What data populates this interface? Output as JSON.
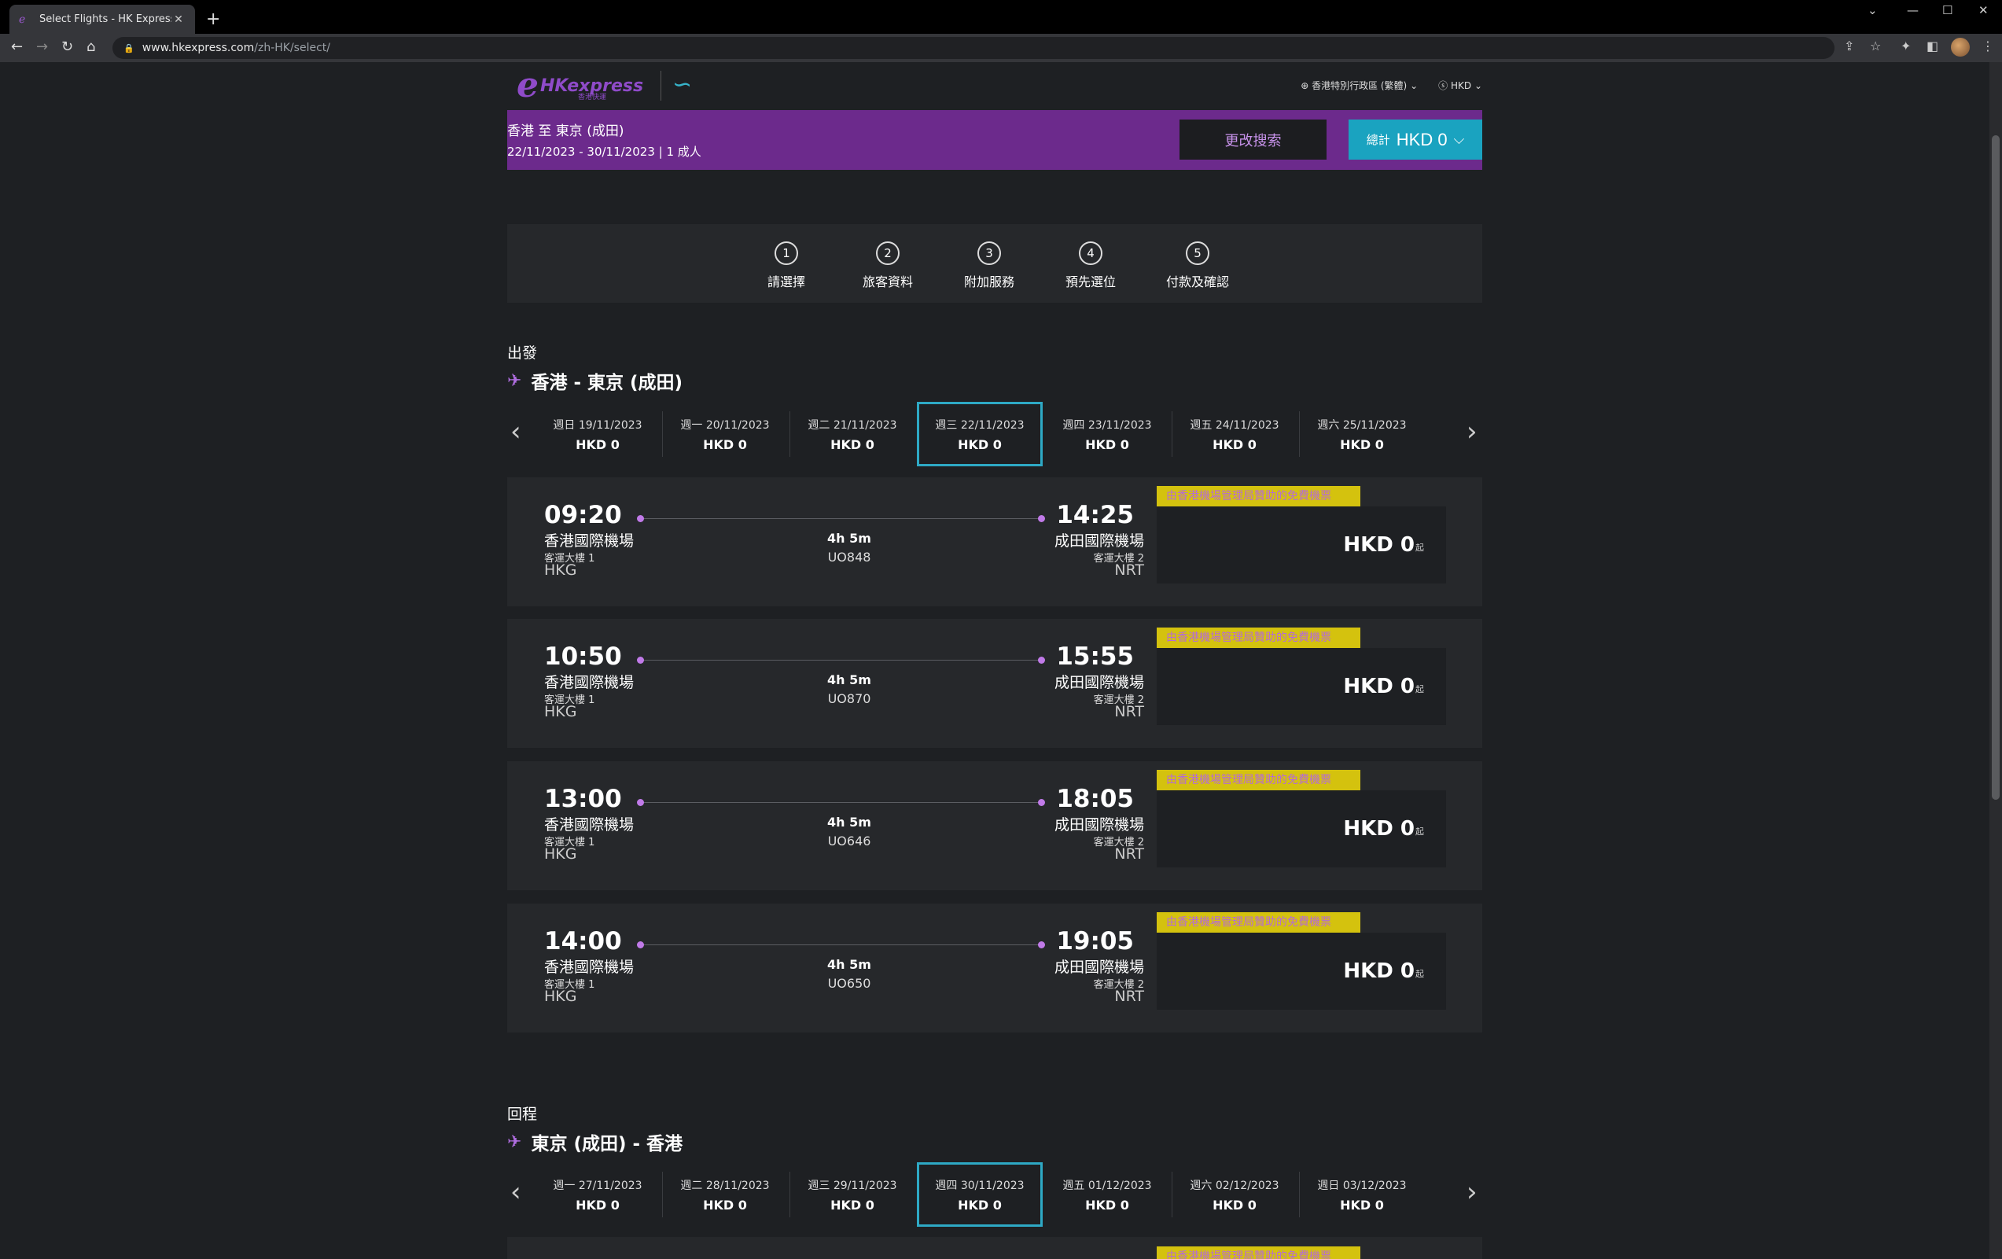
{
  "browser": {
    "tab_title": "Select Flights - HK Express",
    "url_host": "www.hkexpress.com",
    "url_path": "/zh-HK/select/"
  },
  "header": {
    "logo_brand": "express",
    "logo_prefix": "HK",
    "logo_sub": "香港快運",
    "region": "香港特別行政區 (繁體)",
    "currency": "HKD"
  },
  "summary": {
    "route": "香港 至 東京 (成田)",
    "dates": "22/11/2023 - 30/11/2023 | 1 成人",
    "modify_label": "更改搜索",
    "total_label": "總計",
    "total_value": "HKD 0"
  },
  "steps": [
    {
      "num": "1",
      "label": "請選擇"
    },
    {
      "num": "2",
      "label": "旅客資料"
    },
    {
      "num": "3",
      "label": "附加服務"
    },
    {
      "num": "4",
      "label": "預先選位"
    },
    {
      "num": "5",
      "label": "付款及確認"
    }
  ],
  "outbound": {
    "heading": "出發",
    "route": "香港 - 東京 (成田)",
    "dates": [
      {
        "date": "週日 19/11/2023",
        "price": "HKD  0"
      },
      {
        "date": "週一 20/11/2023",
        "price": "HKD  0"
      },
      {
        "date": "週二 21/11/2023",
        "price": "HKD  0"
      },
      {
        "date": "週三 22/11/2023",
        "price": "HKD  0"
      },
      {
        "date": "週四 23/11/2023",
        "price": "HKD  0"
      },
      {
        "date": "週五 24/11/2023",
        "price": "HKD  0"
      },
      {
        "date": "週六 25/11/2023",
        "price": "HKD  0"
      }
    ],
    "flights": [
      {
        "dep_time": "09:20",
        "dep_airport": "香港國際機場",
        "dep_terminal": "客運大樓 1",
        "dep_code": "HKG",
        "duration": "4h 5m",
        "flight_no": "UO848",
        "arr_time": "14:25",
        "arr_airport": "成田國際機場",
        "arr_terminal": "客運大樓 2",
        "arr_code": "NRT",
        "tag": "由香港機場管理局贊助的免費機票",
        "price": "HKD  0",
        "price_suffix": "起"
      },
      {
        "dep_time": "10:50",
        "dep_airport": "香港國際機場",
        "dep_terminal": "客運大樓 1",
        "dep_code": "HKG",
        "duration": "4h 5m",
        "flight_no": "UO870",
        "arr_time": "15:55",
        "arr_airport": "成田國際機場",
        "arr_terminal": "客運大樓 2",
        "arr_code": "NRT",
        "tag": "由香港機場管理局贊助的免費機票",
        "price": "HKD  0",
        "price_suffix": "起"
      },
      {
        "dep_time": "13:00",
        "dep_airport": "香港國際機場",
        "dep_terminal": "客運大樓 1",
        "dep_code": "HKG",
        "duration": "4h 5m",
        "flight_no": "UO646",
        "arr_time": "18:05",
        "arr_airport": "成田國際機場",
        "arr_terminal": "客運大樓 2",
        "arr_code": "NRT",
        "tag": "由香港機場管理局贊助的免費機票",
        "price": "HKD  0",
        "price_suffix": "起"
      },
      {
        "dep_time": "14:00",
        "dep_airport": "香港國際機場",
        "dep_terminal": "客運大樓 1",
        "dep_code": "HKG",
        "duration": "4h 5m",
        "flight_no": "UO650",
        "arr_time": "19:05",
        "arr_airport": "成田國際機場",
        "arr_terminal": "客運大樓 2",
        "arr_code": "NRT",
        "tag": "由香港機場管理局贊助的免費機票",
        "price": "HKD  0",
        "price_suffix": "起"
      }
    ]
  },
  "inbound": {
    "heading": "回程",
    "route": "東京 (成田) - 香港",
    "dates": [
      {
        "date": "週一 27/11/2023",
        "price": "HKD  0"
      },
      {
        "date": "週二 28/11/2023",
        "price": "HKD  0"
      },
      {
        "date": "週三 29/11/2023",
        "price": "HKD  0"
      },
      {
        "date": "週四 30/11/2023",
        "price": "HKD  0"
      },
      {
        "date": "週五 01/12/2023",
        "price": "HKD  0"
      },
      {
        "date": "週六 02/12/2023",
        "price": "HKD  0"
      },
      {
        "date": "週日 03/12/2023",
        "price": "HKD  0"
      }
    ],
    "tag": "由香港機場管理局贊助的免費機票"
  }
}
